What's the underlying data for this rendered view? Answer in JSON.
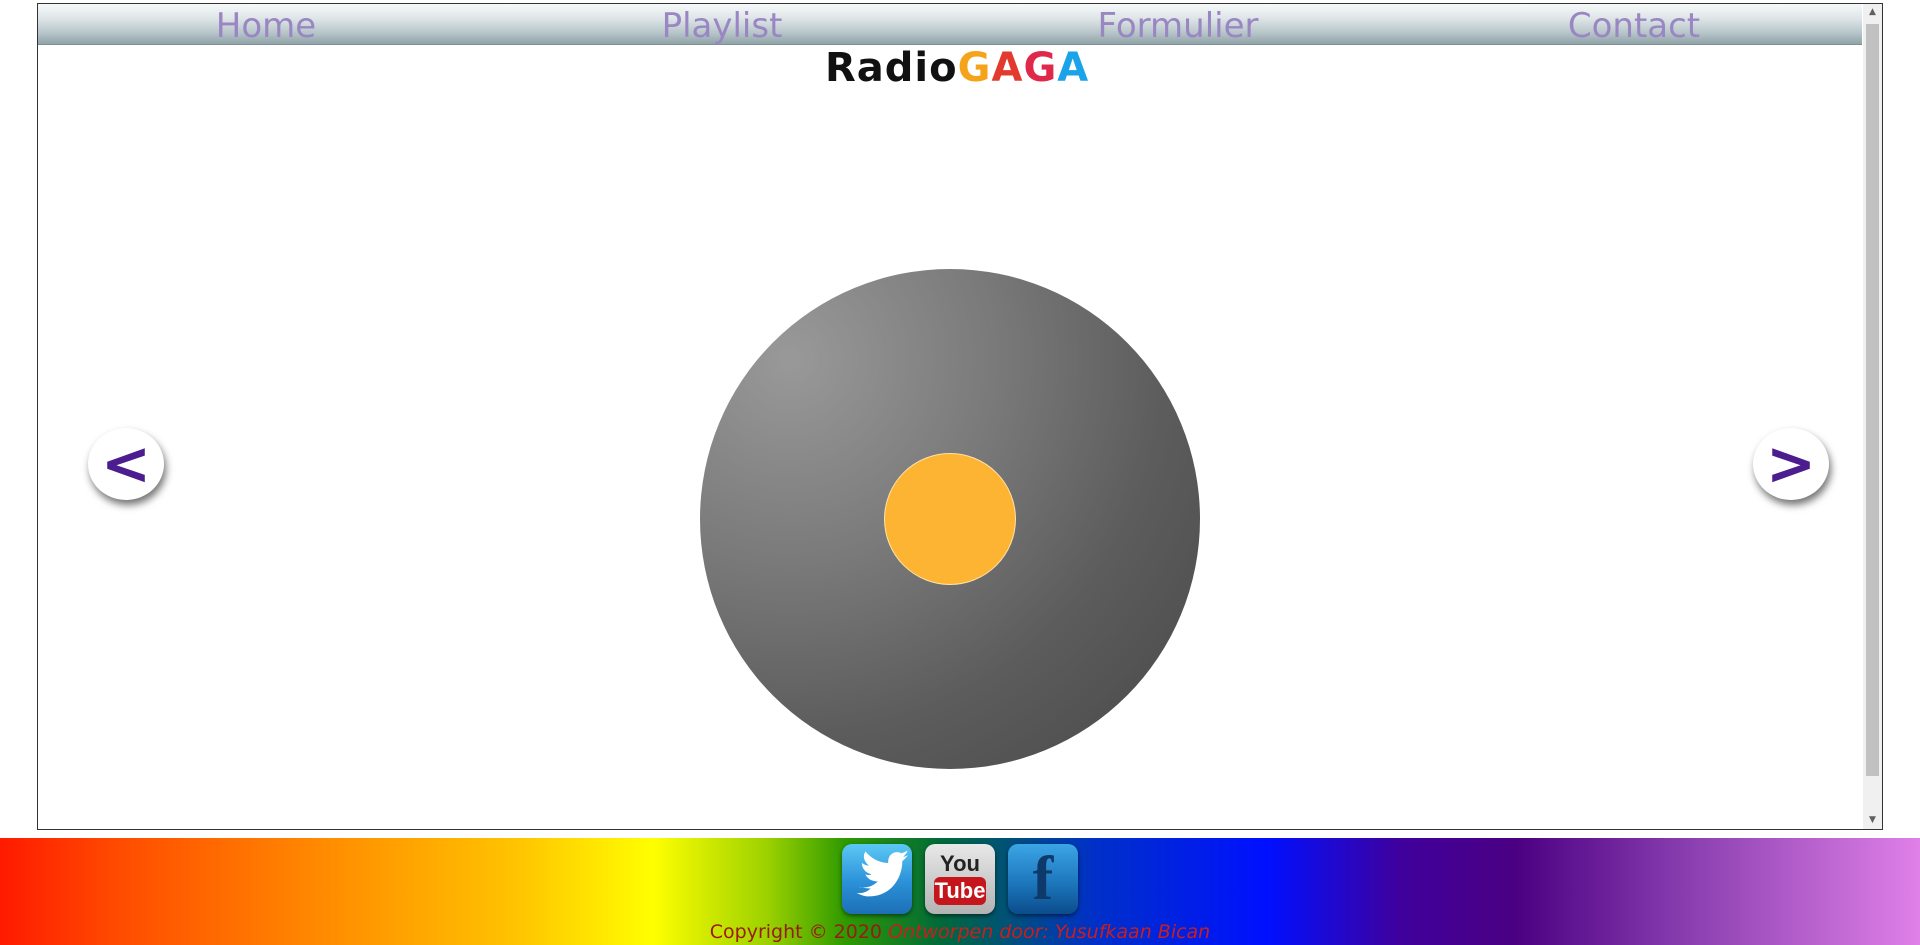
{
  "nav": {
    "items": [
      {
        "label": "Home"
      },
      {
        "label": "Playlist"
      },
      {
        "label": "Formulier"
      },
      {
        "label": "Contact"
      }
    ]
  },
  "logo": {
    "radio": "Radio",
    "letters": [
      "G",
      "A",
      "G",
      "A"
    ]
  },
  "slider": {
    "prev_label": "<",
    "next_label": ">"
  },
  "social": {
    "icons": [
      "twitter-icon",
      "youtube-icon",
      "facebook-icon"
    ],
    "youtube_you": "You",
    "youtube_tube": "Tube",
    "facebook_f": "f"
  },
  "footer": {
    "copyright": "Copyright © 2020 ",
    "designer": "Ontworpen door: Yusufkaan Bican"
  },
  "colors": {
    "nav_text": "#9b86c4",
    "arrow": "#4c1d8e",
    "record_label": "#fdb432",
    "copyright": "#9a1b10"
  }
}
